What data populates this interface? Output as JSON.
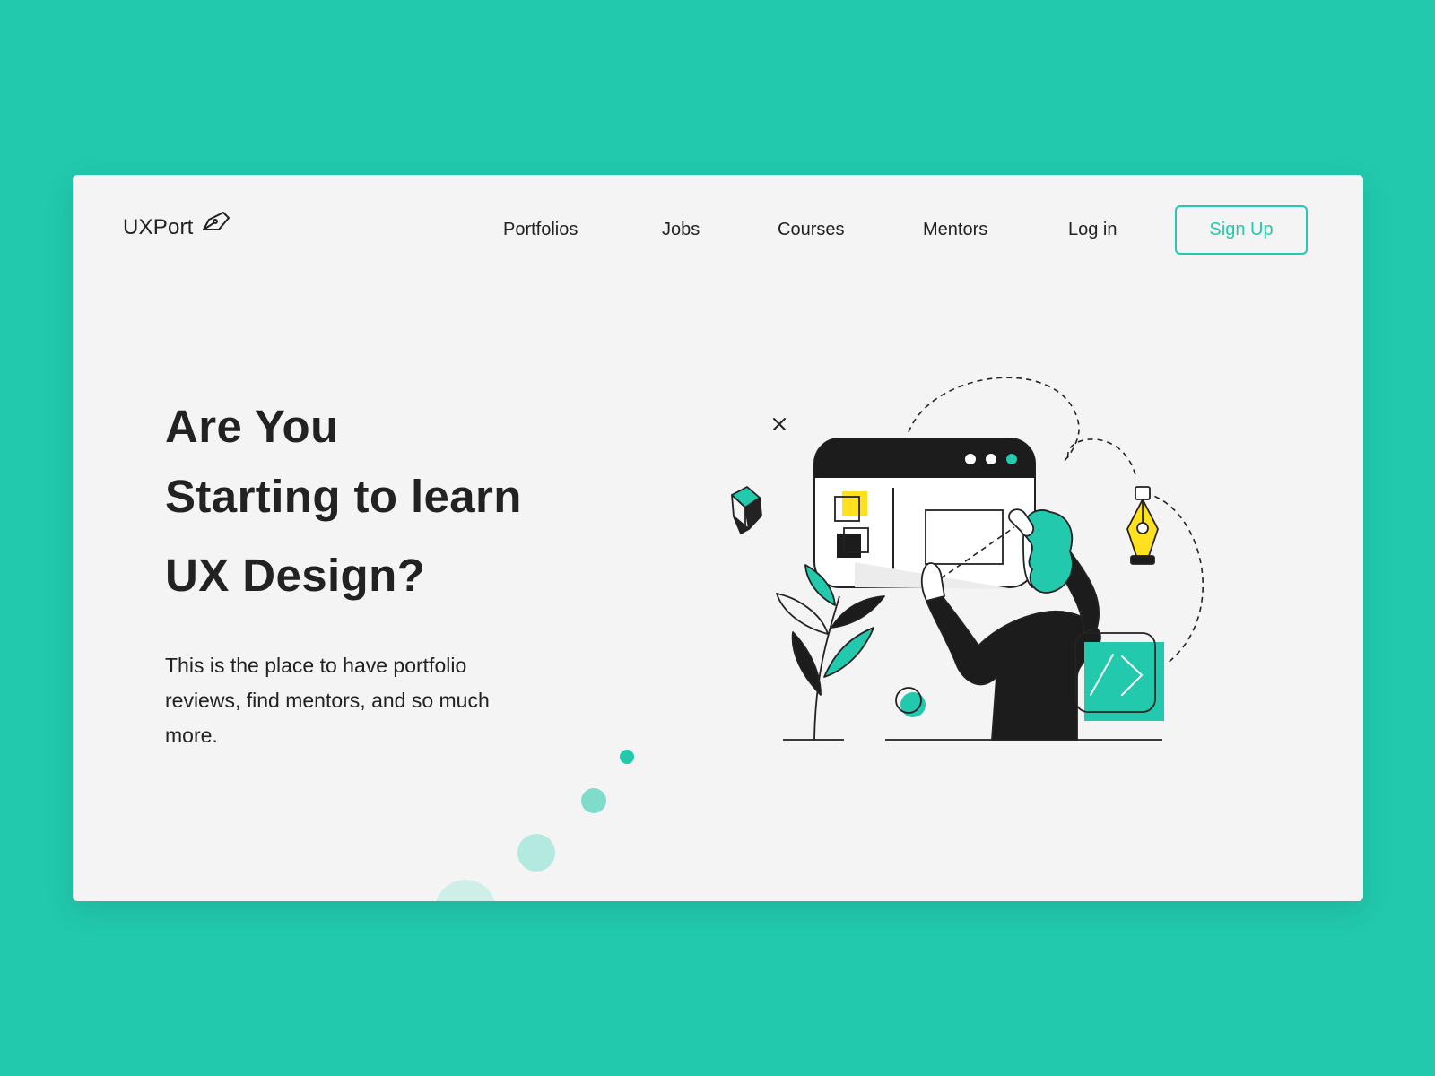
{
  "brand": {
    "name": "UXPort",
    "logo_icon": "pen-nib-icon",
    "accent_color": "#22c9ad"
  },
  "nav": {
    "items": [
      {
        "label": "Portfolios"
      },
      {
        "label": "Jobs"
      },
      {
        "label": "Courses"
      },
      {
        "label": "Mentors"
      }
    ],
    "login_label": "Log in",
    "signup_label": "Sign Up"
  },
  "hero": {
    "headline_lines": [
      "Are You",
      "Starting to learn",
      "UX Design?"
    ],
    "description": "This is the place to have portfolio reviews, find mentors, and so much more."
  },
  "illustration": {
    "subject": "designer-at-browser-window-illustration",
    "colors": {
      "accent": "#22c9ad",
      "highlight": "#ffe11f",
      "ink": "#1c1c1c"
    }
  }
}
